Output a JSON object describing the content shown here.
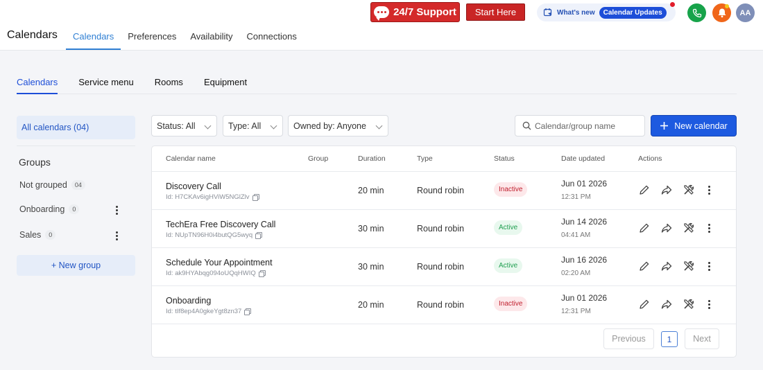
{
  "header": {
    "app_title": "Calendars",
    "tabs": [
      {
        "label": "Calendars",
        "active": true
      },
      {
        "label": "Preferences",
        "active": false
      },
      {
        "label": "Availability",
        "active": false
      },
      {
        "label": "Connections",
        "active": false
      }
    ],
    "support_label": "24/7 Support",
    "start_label": "Start Here",
    "whats_new_label": "What's new",
    "updates_label": "Calendar Updates",
    "avatar_initials": "AA"
  },
  "sub_tabs": [
    {
      "label": "Calendars",
      "active": true
    },
    {
      "label": "Service menu",
      "active": false
    },
    {
      "label": "Rooms",
      "active": false
    },
    {
      "label": "Equipment",
      "active": false
    }
  ],
  "sidebar": {
    "all_calendars_label": "All calendars (04)",
    "groups_title": "Groups",
    "groups": [
      {
        "name": "Not grouped",
        "count": "04"
      },
      {
        "name": "Onboarding",
        "count": "0"
      },
      {
        "name": "Sales",
        "count": "0"
      }
    ],
    "new_group_label": "+ New group"
  },
  "filters": {
    "status": "Status: All",
    "type": "Type: All",
    "owned_by": "Owned by: Anyone",
    "search_placeholder": "Calendar/group name",
    "new_calendar_label": "New calendar"
  },
  "table": {
    "columns": {
      "name": "Calendar name",
      "group": "Group",
      "duration": "Duration",
      "type": "Type",
      "status": "Status",
      "date_updated": "Date updated",
      "actions": "Actions"
    },
    "rows": [
      {
        "name": "Discovery Call",
        "id": "Id: H7CKAv6igHViW5NGlZlv",
        "duration": "20 min",
        "type": "Round robin",
        "status": "Inactive",
        "date": "Jun 01 2026",
        "time": "12:31 PM"
      },
      {
        "name": "TechEra Free Discovery Call",
        "id": "Id: NUpTN96H0i4butQG5wyq",
        "duration": "30 min",
        "type": "Round robin",
        "status": "Active",
        "date": "Jun 14 2026",
        "time": "04:41 AM"
      },
      {
        "name": "Schedule Your Appointment",
        "id": "Id: ak9HYAbqg094oUQqHWIQ",
        "duration": "30 min",
        "type": "Round robin",
        "status": "Active",
        "date": "Jun 16 2026",
        "time": "02:20 AM"
      },
      {
        "name": "Onboarding",
        "id": "Id: tIf8ep4A0gkeYgt8zn37",
        "duration": "20 min",
        "type": "Round robin",
        "status": "Inactive",
        "date": "Jun 01 2026",
        "time": "12:31 PM"
      }
    ]
  },
  "pagination": {
    "previous_label": "Previous",
    "current_page": "1",
    "next_label": "Next"
  },
  "colors": {
    "accent": "#1d5ae0",
    "support_red": "#d42a2a",
    "active_green": "#1e9e4f",
    "inactive_red": "#c0202f"
  },
  "icons": [
    "chat-icon",
    "phone-icon",
    "bell-icon",
    "calendar-update-icon",
    "search-icon",
    "plus-icon",
    "edit-icon",
    "share-icon",
    "tools-icon",
    "kebab-icon",
    "copy-icon"
  ]
}
